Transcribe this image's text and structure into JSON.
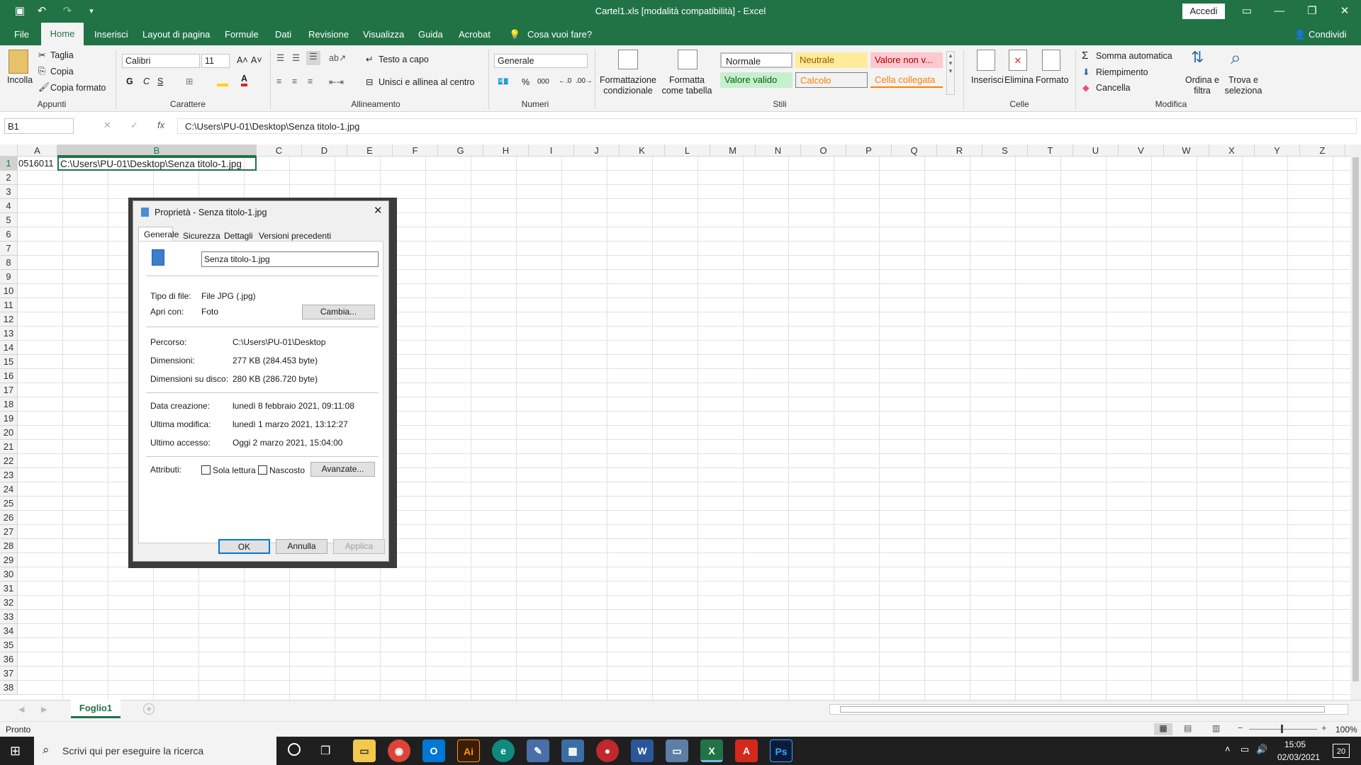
{
  "window": {
    "title": "Cartel1.xls  [modalità compatibilità]  -  Excel",
    "signin": "Accedi"
  },
  "tabs": [
    "File",
    "Home",
    "Inserisci",
    "Layout di pagina",
    "Formule",
    "Dati",
    "Revisione",
    "Visualizza",
    "Guida",
    "Acrobat",
    "Cosa vuoi fare?"
  ],
  "share": "Condividi",
  "ribbon": {
    "clipboard": {
      "paste": "Incolla",
      "cut": "Taglia",
      "copy": "Copia",
      "format_painter": "Copia formato",
      "label": "Appunti"
    },
    "font": {
      "name": "Calibri",
      "size": "11",
      "bold": "G",
      "italic": "C",
      "underline": "S",
      "label": "Carattere"
    },
    "alignment": {
      "wrap": "Testo a capo",
      "merge": "Unisci e allinea al centro",
      "label": "Allineamento"
    },
    "number": {
      "format": "Generale",
      "percent": "%",
      "thousands": "000",
      "label": "Numeri"
    },
    "styles": {
      "cond": "Formattazione condizionale",
      "table": "Formatta come tabella",
      "normal": "Normale",
      "neutral": "Neutrale",
      "bad": "Valore non v...",
      "good": "Valore valido",
      "calc": "Calcolo",
      "linked": "Cella collegata",
      "label": "Stili"
    },
    "cells": {
      "insert": "Inserisci",
      "delete": "Elimina",
      "format": "Formato",
      "label": "Celle"
    },
    "editing": {
      "autosum": "Somma automatica",
      "fill": "Riempimento",
      "clear": "Cancella",
      "sort": "Ordina e filtra",
      "find": "Trova e seleziona",
      "label": "Modifica"
    }
  },
  "formula": {
    "namebox": "B1",
    "content": "C:\\Users\\PU-01\\Desktop\\Senza titolo-1.jpg"
  },
  "columns": [
    "A",
    "B",
    "C",
    "D",
    "E",
    "F",
    "G",
    "H",
    "I",
    "J",
    "K",
    "L",
    "M",
    "N",
    "O",
    "P",
    "Q",
    "R",
    "S",
    "T",
    "U",
    "V",
    "W",
    "X",
    "Y",
    "Z"
  ],
  "rows": [
    "1",
    "2",
    "3",
    "4",
    "5",
    "6",
    "7",
    "8",
    "9",
    "10",
    "11",
    "12",
    "13",
    "14",
    "15",
    "16",
    "17",
    "18",
    "19",
    "20",
    "21",
    "22",
    "23",
    "24",
    "25",
    "26",
    "27",
    "28",
    "29",
    "30",
    "31",
    "32",
    "33",
    "34",
    "35",
    "36",
    "37",
    "38"
  ],
  "cells": {
    "A1": "0516011",
    "B1": "C:\\Users\\PU-01\\Desktop\\Senza titolo-1.jpg"
  },
  "dialog": {
    "title": "Proprietà - Senza titolo-1.jpg",
    "tabs": [
      "Generale",
      "Sicurezza",
      "Dettagli",
      "Versioni precedenti"
    ],
    "filename": "Senza titolo-1.jpg",
    "type_label": "Tipo di file:",
    "type_value": "File JPG (.jpg)",
    "open_label": "Apri con:",
    "open_value": "Foto",
    "change": "Cambia...",
    "path_label": "Percorso:",
    "path_value": "C:\\Users\\PU-01\\Desktop",
    "size_label": "Dimensioni:",
    "size_value": "277 KB (284.453 byte)",
    "disk_label": "Dimensioni su disco:",
    "disk_value": "280 KB (286.720 byte)",
    "created_label": "Data creazione:",
    "created_value": "lunedì 8 febbraio 2021, 09:11:08",
    "modified_label": "Ultima modifica:",
    "modified_value": "lunedì 1 marzo 2021, 13:12:27",
    "accessed_label": "Ultimo accesso:",
    "accessed_value": "Oggi 2 marzo 2021, 15:04:00",
    "attr_label": "Attributi:",
    "readonly": "Sola lettura",
    "hidden": "Nascosto",
    "advanced": "Avanzate...",
    "ok": "OK",
    "cancel": "Annulla",
    "apply": "Applica"
  },
  "sheet": {
    "tab": "Foglio1"
  },
  "status": {
    "ready": "Pronto",
    "zoom": "100%"
  },
  "taskbar": {
    "search": "Scrivi qui per eseguire la ricerca",
    "time": "15:05",
    "date": "02/03/2021",
    "notif": "20"
  }
}
